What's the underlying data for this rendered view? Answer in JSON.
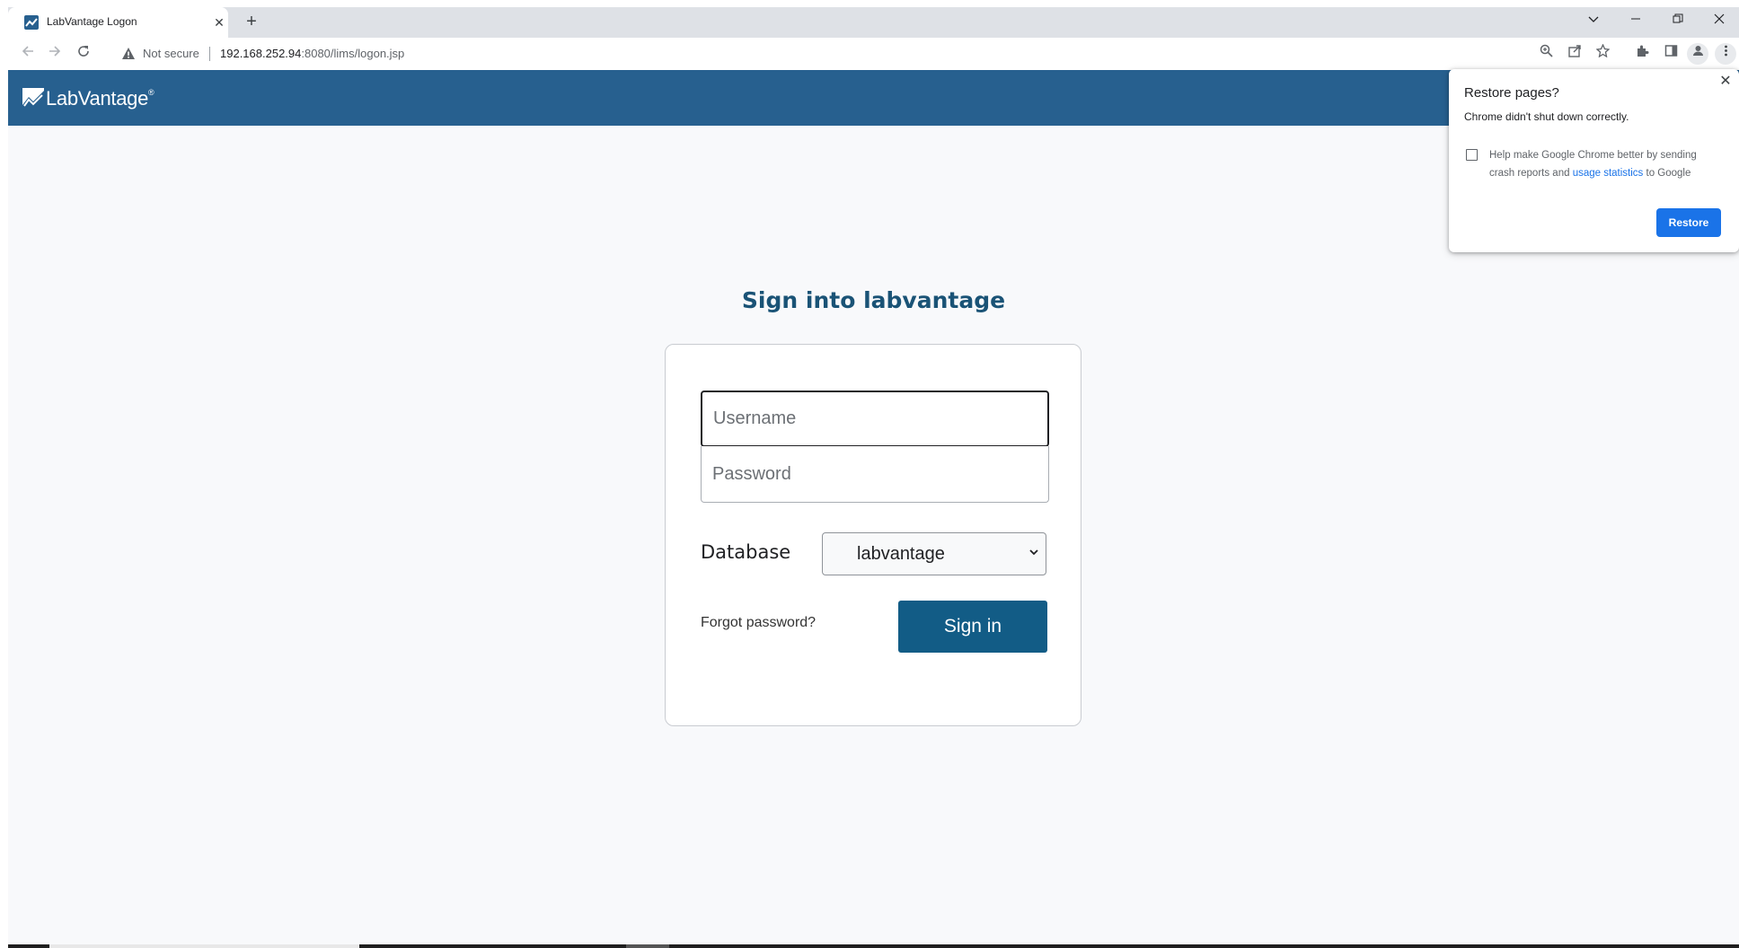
{
  "browser": {
    "tab": {
      "title": "LabVantage Logon"
    },
    "omnibox": {
      "security_label": "Not secure",
      "url_host": "192.168.252.94",
      "url_path": ":8080/lims/logon.jsp"
    },
    "window_controls": {
      "tab_search_icon": "chevron-down-icon",
      "minimize_icon": "minimize-icon",
      "restore_icon": "restore-window-icon",
      "close_icon": "close-icon"
    }
  },
  "header": {
    "logo_text": "LabVantage",
    "logo_mark": "®"
  },
  "login": {
    "title": "Sign into labvantage",
    "username_placeholder": "Username",
    "password_placeholder": "Password",
    "database_label": "Database",
    "database_value": "labvantage",
    "forgot_password": "Forgot password?",
    "signin_button": "Sign in"
  },
  "restore_popup": {
    "title": "Restore pages?",
    "message": "Chrome didn't shut down correctly.",
    "help_before": "Help make Google Chrome better by sending crash reports and ",
    "help_link": "usage statistics",
    "help_after": " to Google",
    "button": "Restore"
  },
  "colors": {
    "header": "#27608f",
    "title": "#1a5376",
    "signin_button": "#125c86",
    "restore_button": "#1a73e8"
  }
}
